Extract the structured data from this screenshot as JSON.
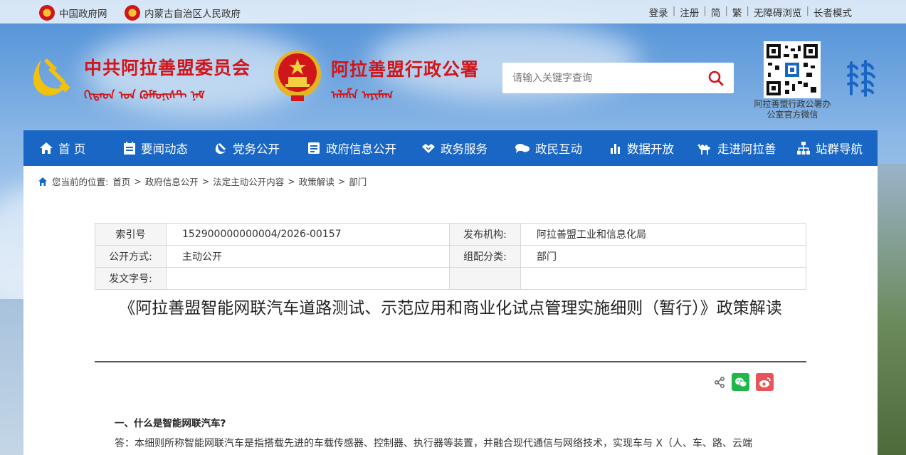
{
  "topbar": {
    "link_gov": "中国政府网",
    "link_nmg": "内蒙古自治区人民政府",
    "right": [
      "登录",
      "注册",
      "简",
      "繁",
      "无障碍浏览",
      "长者模式"
    ]
  },
  "header": {
    "party_title": "中共阿拉善盟委员会",
    "gov_title": "阿拉善盟行政公署",
    "mongolian_party": "ᠬᠢᠲᠠᠳ ᠤᠨ ᠺᠣᠮᠮᠤᠨᠢᠰᠲ ᠨᠠᠮ",
    "mongolian_gov": "ᠠᠯᠠᠱᠠ ᠠᠶᠢᠮᠠᠭ",
    "search_placeholder": "请输入关键字查询",
    "qr_caption": "阿拉善盟行政公署办公室官方微信"
  },
  "nav": {
    "items": [
      "首 页",
      "要闻动态",
      "党务公开",
      "政府信息公开",
      "政务服务",
      "政民互动",
      "数据开放",
      "走进阿拉善",
      "站群导航"
    ]
  },
  "breadcrumb": {
    "label": "您当前的位置:",
    "items": [
      "首页",
      "政府信息公开",
      "法定主动公开内容",
      "政策解读",
      "部门"
    ],
    "sep": ">"
  },
  "meta": {
    "index_label": "索引号",
    "index_value": "152900000000004/2026-00157",
    "org_label": "发布机构:",
    "org_value": "阿拉善盟工业和信息化局",
    "mode_label": "公开方式:",
    "mode_value": "主动公开",
    "cat_label": "组配分类:",
    "cat_value": "部门",
    "docno_label": "发文字号:",
    "docno_value": ""
  },
  "article": {
    "title": "《阿拉善盟智能网联汽车道路测试、示范应用和商业化试点管理实施细则（暂行）》政策解读",
    "q1": "一、什么是智能网联汽车?",
    "a1": "答：本细则所称智能网联汽车是指搭载先进的车载传感器、控制器、执行器等装置，并融合现代通信与网络技术，实现车与 X（人、车、路、云端"
  },
  "colors": {
    "nav_bg": "#1a66c4",
    "title_red": "#d0161b",
    "wechat": "#20b74a",
    "weibo": "#e8545a"
  }
}
